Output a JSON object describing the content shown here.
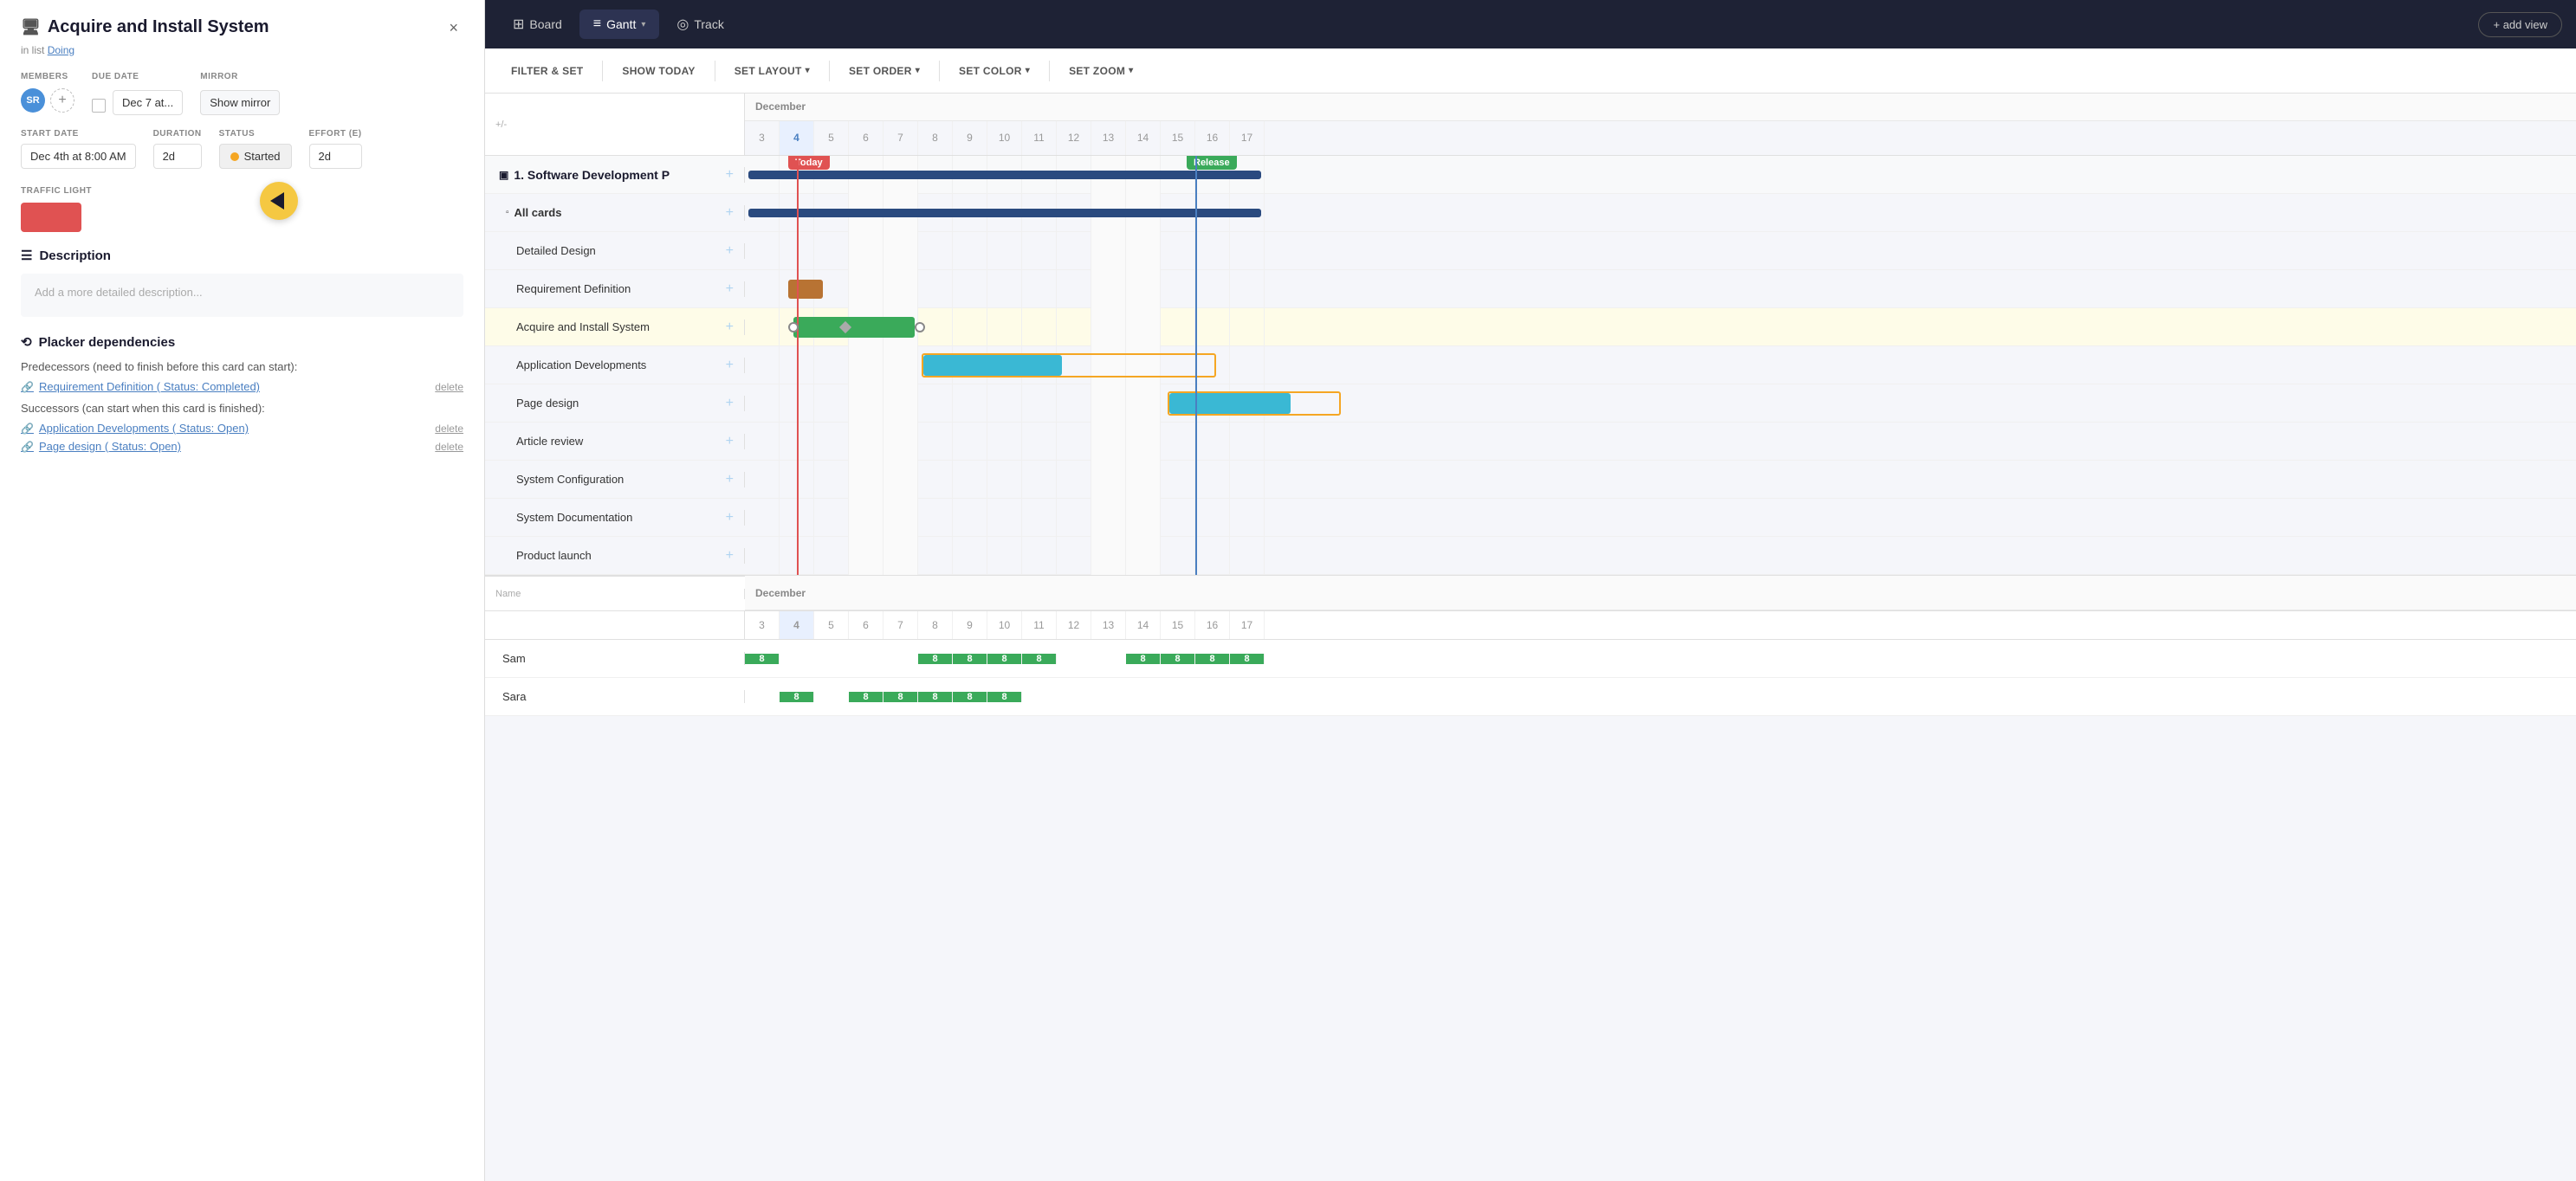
{
  "leftPanel": {
    "title": "Acquire and Install System",
    "titleIcon": "🖥",
    "inList": "in list",
    "listName": "Doing",
    "closeLabel": "×",
    "members": {
      "label": "MEMBERS",
      "avatarText": "SR"
    },
    "dueDate": {
      "label": "DUE DATE",
      "value": "Dec 7 at..."
    },
    "mirror": {
      "label": "MIRROR",
      "buttonLabel": "Show mirror"
    },
    "startDate": {
      "label": "START DATE",
      "value": "Dec 4th at 8:00 AM"
    },
    "duration": {
      "label": "DURATION",
      "value": "2d"
    },
    "status": {
      "label": "STATUS",
      "value": "Started"
    },
    "effort": {
      "label": "EFFORT (E)",
      "value": "2d"
    },
    "trafficLight": {
      "label": "TRAFFIC LIGHT"
    },
    "description": {
      "title": "Description",
      "placeholder": "Add a more detailed description..."
    },
    "dependencies": {
      "title": "Placker dependencies",
      "predecessorLabel": "Predecessors (need to finish before this card can start):",
      "predecessors": [
        {
          "text": "Requirement Definition ( Status: Completed)",
          "deleteLabel": "delete"
        }
      ],
      "successorLabel": "Successors (can start when this card is finished):",
      "successors": [
        {
          "text": "Application Developments ( Status: Open)",
          "deleteLabel": "delete"
        },
        {
          "text": "Page design ( Status: Open)",
          "deleteLabel": "delete"
        }
      ]
    }
  },
  "topBar": {
    "tabs": [
      {
        "id": "board",
        "label": "Board",
        "icon": "⊞"
      },
      {
        "id": "gantt",
        "label": "Gantt",
        "icon": "≡",
        "active": true
      },
      {
        "id": "track",
        "label": "Track",
        "icon": "◎"
      }
    ],
    "addViewLabel": "+ add view"
  },
  "toolbar": {
    "filterLabel": "FILTER & SET",
    "showTodayLabel": "SHOW TODAY",
    "setLayoutLabel": "SET LAYOUT",
    "setOrderLabel": "SET ORDER",
    "setColorLabel": "SET COLOR",
    "setZoomLabel": "SET ZOOM",
    "chevron": "▾"
  },
  "gantt": {
    "plusMinus": "+/-",
    "monthLabel": "December",
    "days": [
      3,
      4,
      5,
      6,
      7,
      8,
      9,
      10,
      11,
      12,
      13,
      14,
      15,
      16,
      17
    ],
    "todayDay": 4,
    "groups": [
      {
        "id": "g1",
        "label": "1. Software Development P",
        "type": "group",
        "tasks": [
          {
            "id": "allcards",
            "label": "All cards",
            "type": "subgroup"
          },
          {
            "id": "t1",
            "label": "Detailed Design",
            "type": "task"
          },
          {
            "id": "t2",
            "label": "Requirement Definition",
            "type": "task"
          },
          {
            "id": "t3",
            "label": "Acquire and Install System",
            "type": "task",
            "highlighted": true
          },
          {
            "id": "t4",
            "label": "Application Developments",
            "type": "task"
          },
          {
            "id": "t5",
            "label": "Page design",
            "type": "task"
          },
          {
            "id": "t6",
            "label": "Article review",
            "type": "task"
          },
          {
            "id": "t7",
            "label": "System Configuration",
            "type": "task"
          },
          {
            "id": "t8",
            "label": "System Documentation",
            "type": "task"
          },
          {
            "id": "t9",
            "label": "Product launch",
            "type": "task"
          }
        ]
      }
    ],
    "nameColumnLabel": "Name",
    "resources": [
      {
        "name": "Sam",
        "cells": [
          {
            "day": 3,
            "value": "8",
            "filled": true
          },
          {
            "day": 4,
            "value": "",
            "filled": false
          },
          {
            "day": 5,
            "value": "",
            "filled": false
          },
          {
            "day": 6,
            "value": "",
            "filled": false
          },
          {
            "day": 7,
            "value": "",
            "filled": false
          },
          {
            "day": 8,
            "value": "8",
            "filled": true
          },
          {
            "day": 9,
            "value": "8",
            "filled": true
          },
          {
            "day": 10,
            "value": "8",
            "filled": true
          },
          {
            "day": 11,
            "value": "8",
            "filled": true
          },
          {
            "day": 12,
            "value": "",
            "filled": false
          },
          {
            "day": 13,
            "value": "",
            "filled": false
          },
          {
            "day": 14,
            "value": "8",
            "filled": true
          },
          {
            "day": 15,
            "value": "8",
            "filled": true
          },
          {
            "day": 16,
            "value": "8",
            "filled": true
          },
          {
            "day": 17,
            "value": "8",
            "filled": true
          }
        ]
      },
      {
        "name": "Sara",
        "cells": [
          {
            "day": 3,
            "value": "",
            "filled": false
          },
          {
            "day": 4,
            "value": "8",
            "filled": true
          },
          {
            "day": 5,
            "value": "",
            "filled": false
          },
          {
            "day": 6,
            "value": "8",
            "filled": true
          },
          {
            "day": 7,
            "value": "8",
            "filled": true
          },
          {
            "day": 8,
            "value": "8",
            "filled": true
          },
          {
            "day": 9,
            "value": "8",
            "filled": true
          },
          {
            "day": 10,
            "value": "8",
            "filled": true
          },
          {
            "day": 11,
            "value": "",
            "filled": false
          },
          {
            "day": 12,
            "value": "",
            "filled": false
          },
          {
            "day": 13,
            "value": "",
            "filled": false
          },
          {
            "day": 14,
            "value": "",
            "filled": false
          },
          {
            "day": 15,
            "value": "",
            "filled": false
          },
          {
            "day": 16,
            "value": "",
            "filled": false
          },
          {
            "day": 17,
            "value": "",
            "filled": false
          }
        ]
      }
    ]
  }
}
